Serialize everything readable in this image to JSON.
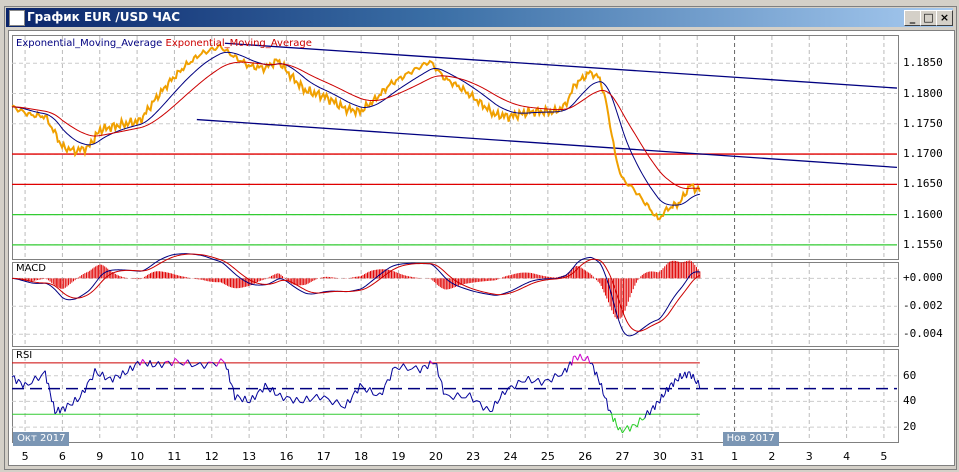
{
  "window": {
    "title": "График EUR /USD  ЧАС",
    "min": "_",
    "max": "□",
    "close": "×"
  },
  "legend": {
    "ema_fast": "Exponential_Moving_Average",
    "ema_slow": "Exponential_Moving_Average"
  },
  "panels": {
    "macd": "MACD",
    "rsi": "RSI"
  },
  "colors": {
    "price": "#f0a000",
    "ema_fast": "#000080",
    "ema_slow": "#cc0000",
    "resistance": "#e00000",
    "support": "#33cc33",
    "trend": "#000080"
  },
  "chart_data": [
    {
      "type": "line",
      "title": "EUR/USD H1",
      "ylim": [
        1.153,
        1.1895
      ],
      "xlim": [
        -0.35,
        23.35
      ],
      "price_ticks": [
        "1.1850",
        "1.1800",
        "1.1750",
        "1.1700",
        "1.1650",
        "1.1600",
        "1.1550"
      ],
      "price_tick_values": [
        1.185,
        1.18,
        1.175,
        1.17,
        1.165,
        1.16,
        1.155
      ],
      "price": {
        "x": [
          -0.35,
          0.13,
          0.54,
          0.8,
          0.99,
          1.34,
          1.69,
          2.01,
          2.54,
          3.08,
          3.48,
          3.88,
          4.28,
          4.69,
          5.22,
          5.62,
          6.02,
          6.43,
          6.77,
          7.1,
          7.5,
          8.03,
          8.57,
          8.97,
          9.37,
          9.77,
          10.31,
          10.84,
          11.24,
          11.65,
          12.18,
          12.58,
          12.99,
          13.52,
          14.19,
          14.46,
          14.73,
          15.13,
          15.39,
          15.58,
          15.8,
          15.98,
          16.33,
          16.73,
          16.95,
          17.22,
          17.54,
          17.8,
          18.07
        ],
        "y": [
          1.1778,
          1.1765,
          1.1762,
          1.1735,
          1.1712,
          1.1705,
          1.1711,
          1.174,
          1.1748,
          1.1755,
          1.179,
          1.182,
          1.1845,
          1.1865,
          1.1878,
          1.186,
          1.1845,
          1.1842,
          1.1855,
          1.183,
          1.1805,
          1.1795,
          1.1775,
          1.177,
          1.179,
          1.1815,
          1.1835,
          1.1853,
          1.1825,
          1.181,
          1.1785,
          1.1765,
          1.1762,
          1.177,
          1.177,
          1.178,
          1.1815,
          1.1835,
          1.1825,
          1.178,
          1.17,
          1.166,
          1.164,
          1.161,
          1.1592,
          1.161,
          1.162,
          1.1648,
          1.164
        ]
      },
      "horizontal_lines": [
        {
          "value": 1.17,
          "kind": "resistance"
        },
        {
          "value": 1.165,
          "kind": "resistance"
        },
        {
          "value": 1.16,
          "kind": "support"
        },
        {
          "value": 1.155,
          "kind": "support"
        }
      ],
      "trendlines": [
        {
          "x": [
            5.35,
            23.35
          ],
          "y": [
            1.1883,
            1.1809
          ]
        },
        {
          "x": [
            4.6,
            23.35
          ],
          "y": [
            1.1757,
            1.1678
          ]
        }
      ]
    },
    {
      "type": "bar",
      "title": "MACD",
      "ylim": [
        -0.0047,
        0.0011
      ],
      "ticks": [
        "+0.000",
        "-0.002",
        "-0.004"
      ],
      "tick_values": [
        0,
        -0.002,
        -0.004
      ]
    },
    {
      "type": "line",
      "title": "RSI",
      "ylim": [
        10,
        80
      ],
      "ticks": [
        "60",
        "40",
        "20"
      ],
      "tick_values": [
        60,
        40,
        20
      ],
      "levels": [
        70,
        50,
        30
      ],
      "x": [
        -0.35,
        0,
        0.54,
        0.8,
        1.07,
        1.47,
        1.87,
        2.28,
        2.68,
        3.08,
        3.48,
        4.02,
        4.69,
        5.35,
        5.62,
        6.02,
        6.43,
        6.83,
        7.36,
        7.9,
        8.57,
        8.97,
        9.5,
        9.91,
        10.58,
        10.98,
        11.25,
        11.91,
        12.45,
        12.85,
        13.39,
        13.92,
        14.46,
        14.73,
        15.13,
        15.39,
        15.66,
        15.93,
        16.33,
        16.73,
        17.0,
        17.27,
        17.54,
        17.8,
        18.07
      ],
      "y": [
        59,
        52,
        62,
        32,
        35,
        43,
        63,
        57,
        62,
        71,
        68,
        71,
        68,
        71,
        44,
        40,
        52,
        44,
        40,
        44,
        36,
        52,
        44,
        67,
        65,
        71,
        44,
        44,
        32,
        48,
        57,
        55,
        63,
        75,
        72,
        55,
        32,
        17,
        21,
        32,
        41,
        52,
        59,
        62,
        52
      ]
    }
  ],
  "xaxis": {
    "labels": [
      "5",
      "6",
      "9",
      "10",
      "11",
      "12",
      "13",
      "16",
      "17",
      "18",
      "19",
      "20",
      "23",
      "24",
      "25",
      "26",
      "27",
      "30",
      "31",
      "1",
      "2",
      "3",
      "4",
      "5"
    ],
    "months": [
      {
        "label": "Окт 2017",
        "index": 0
      },
      {
        "label": "Нов 2017",
        "index": 19
      }
    ]
  }
}
